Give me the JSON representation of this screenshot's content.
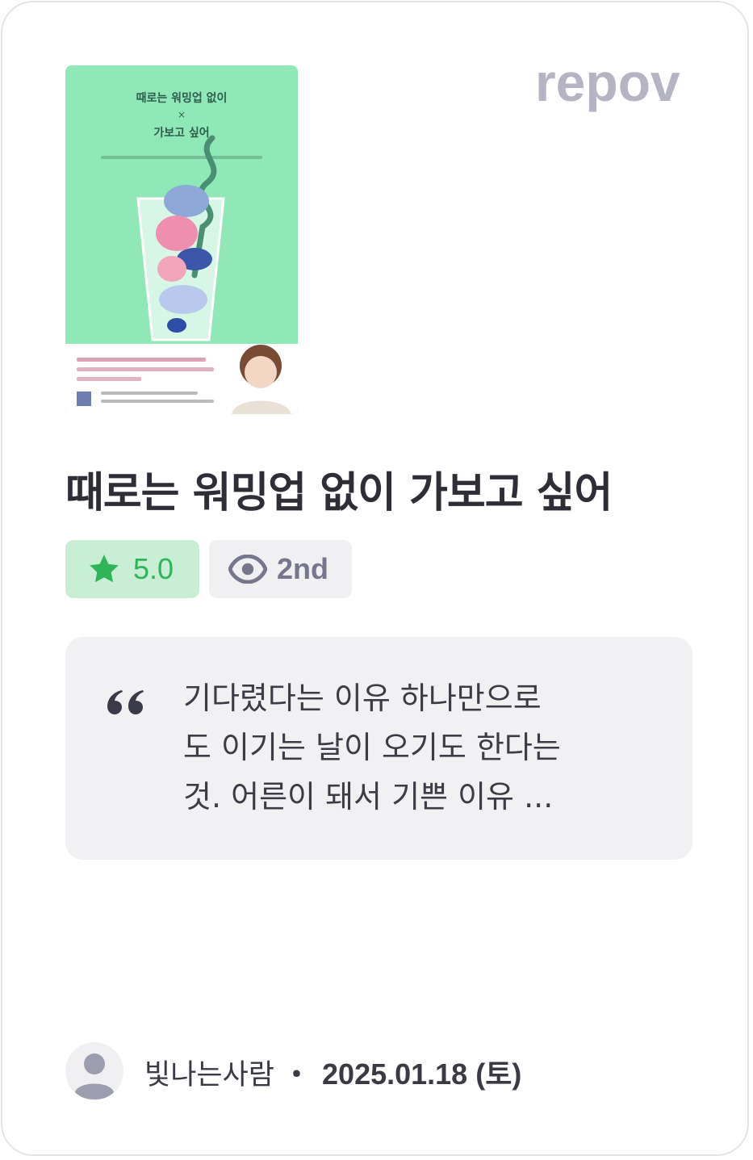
{
  "brand": {
    "logo_text": "repov",
    "logo_color": "#b4b4c2"
  },
  "book": {
    "title": "때로는 워밍업 없이 가보고 싶어",
    "cover": {
      "title_line1": "때로는 워밍업 없이",
      "title_mark": "×",
      "title_line2": "가보고 싶어",
      "background_color": "#8fe8b6"
    }
  },
  "badges": {
    "rating": {
      "icon": "star-icon",
      "value": "5.0",
      "color": "#2fb45a"
    },
    "read_count": {
      "icon": "eye-icon",
      "value": "2nd"
    }
  },
  "quote": {
    "icon": "quote-icon",
    "lines": [
      "기다렸다는 이유 하나만으로",
      "도 이기는 날이 오기도 한다는",
      "것. 어른이 돼서 기쁜 이유 ..."
    ]
  },
  "author": {
    "avatar_icon": "user-avatar-icon",
    "name": "빛나는사람",
    "separator": "・",
    "date": "2025.01.18 (토)"
  }
}
